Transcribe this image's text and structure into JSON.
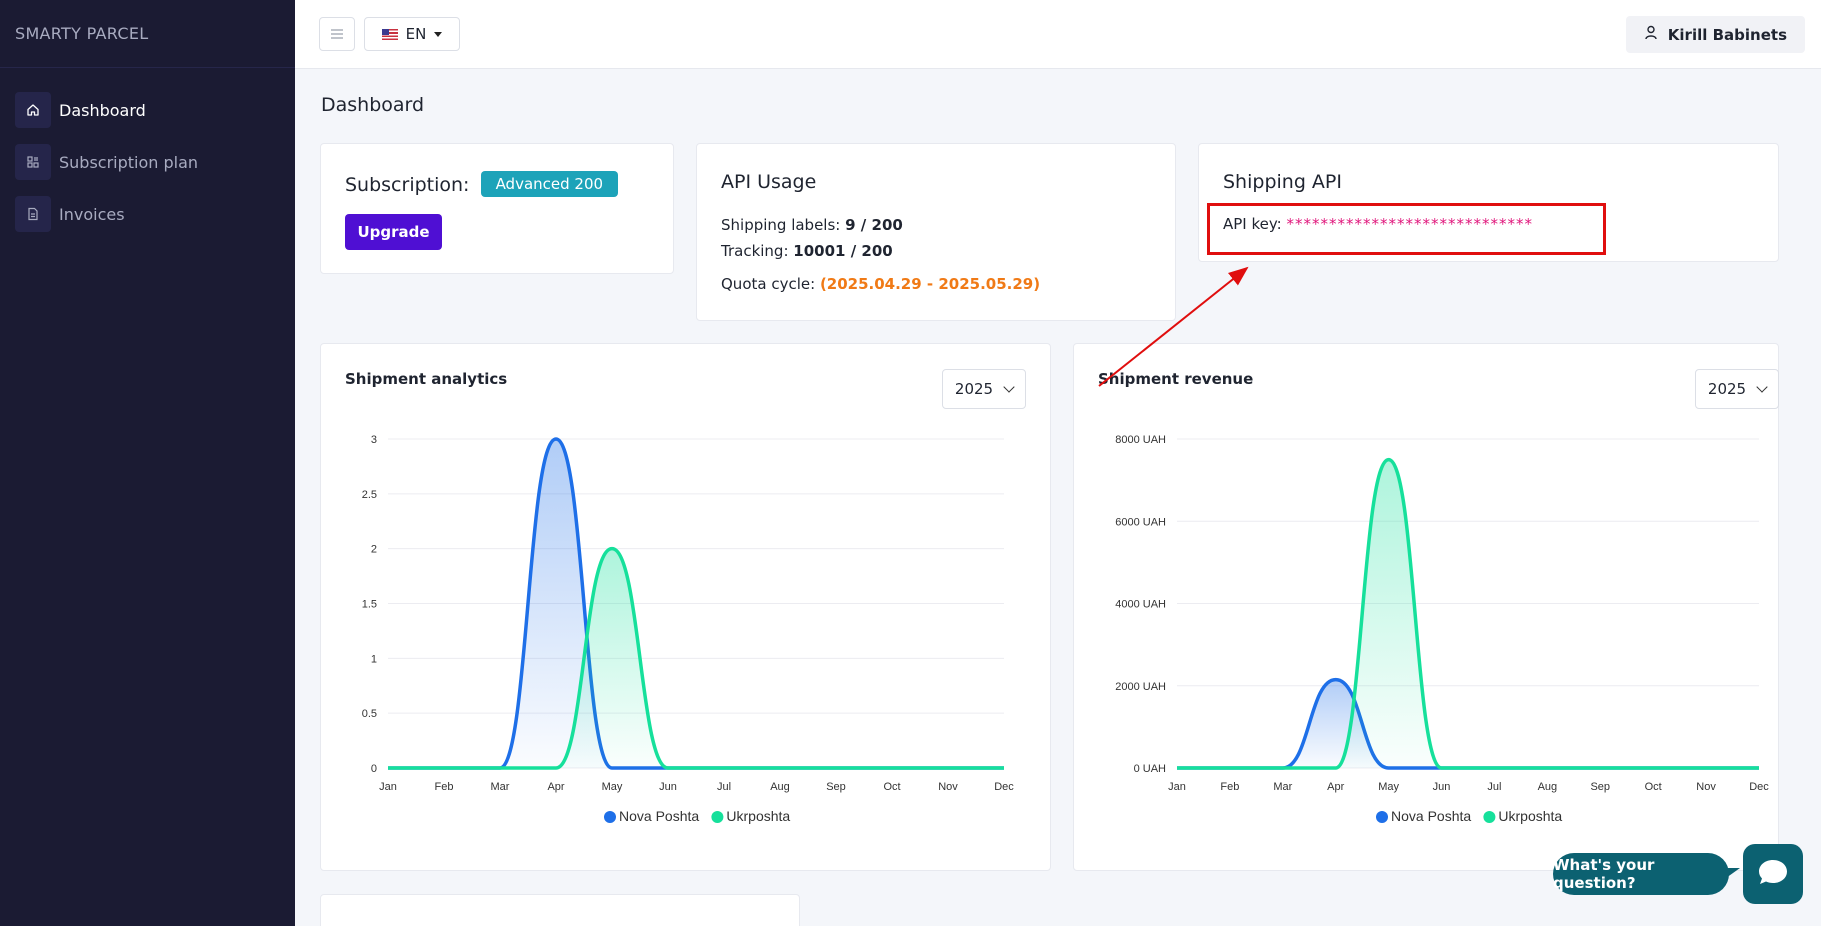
{
  "brand": "SMARTY PARCEL",
  "sidebar": {
    "items": [
      {
        "label": "Dashboard",
        "icon": "home-icon",
        "active": true
      },
      {
        "label": "Subscription plan",
        "icon": "apps-icon",
        "active": false
      },
      {
        "label": "Invoices",
        "icon": "document-icon",
        "active": false
      }
    ]
  },
  "header": {
    "language": "EN",
    "user_name": "Kirill Babinets"
  },
  "page_title": "Dashboard",
  "subscription": {
    "label": "Subscription:",
    "plan": "Advanced 200",
    "upgrade_label": "Upgrade"
  },
  "api_usage": {
    "title": "API Usage",
    "shipping_labels_label": "Shipping labels:",
    "shipping_labels_value": "9 / 200",
    "tracking_label": "Tracking:",
    "tracking_value": "10001 / 200",
    "quota_label": "Quota cycle:",
    "quota_value": "(2025.04.29 - 2025.05.29)"
  },
  "shipping_api": {
    "title": "Shipping API",
    "key_label": "API key:",
    "key_value": "*****************************"
  },
  "colors": {
    "sidebar_bg": "#1b1b33",
    "nova_poshta": "#1e6fe8",
    "ukrposhta": "#16e09b",
    "accent": "#4f0fd3",
    "badge": "#1da3b9",
    "chat": "#0c6171",
    "annotation": "#e00e0e"
  },
  "chat": {
    "prompt": "What's your question?"
  },
  "chart_data": [
    {
      "type": "area",
      "title": "Shipment analytics",
      "year": "2025",
      "categories": [
        "Jan",
        "Feb",
        "Mar",
        "Apr",
        "May",
        "Jun",
        "Jul",
        "Aug",
        "Sep",
        "Oct",
        "Nov",
        "Dec"
      ],
      "y_ticks": [
        "0",
        "0.5",
        "1",
        "1.5",
        "2",
        "2.5",
        "3"
      ],
      "ylim": [
        0,
        3
      ],
      "series": [
        {
          "name": "Nova Poshta",
          "values": [
            0,
            0,
            0,
            3,
            0,
            0,
            0,
            0,
            0,
            0,
            0,
            0
          ]
        },
        {
          "name": "Ukrposhta",
          "values": [
            0,
            0,
            0,
            0,
            2,
            0,
            0,
            0,
            0,
            0,
            0,
            0
          ]
        }
      ],
      "legend": "bottom"
    },
    {
      "type": "area",
      "title": "Shipment revenue",
      "year": "2025",
      "categories": [
        "Jan",
        "Feb",
        "Mar",
        "Apr",
        "May",
        "Jun",
        "Jul",
        "Aug",
        "Sep",
        "Oct",
        "Nov",
        "Dec"
      ],
      "y_ticks": [
        "0 UAH",
        "2000 UAH",
        "4000 UAH",
        "6000 UAH",
        "8000 UAH"
      ],
      "ylim": [
        0,
        8000
      ],
      "series": [
        {
          "name": "Nova Poshta",
          "values": [
            0,
            0,
            0,
            2150,
            0,
            0,
            0,
            0,
            0,
            0,
            0,
            0
          ]
        },
        {
          "name": "Ukrposhta",
          "values": [
            0,
            0,
            0,
            0,
            7500,
            0,
            0,
            0,
            0,
            0,
            0,
            0
          ]
        }
      ],
      "legend": "bottom"
    }
  ]
}
